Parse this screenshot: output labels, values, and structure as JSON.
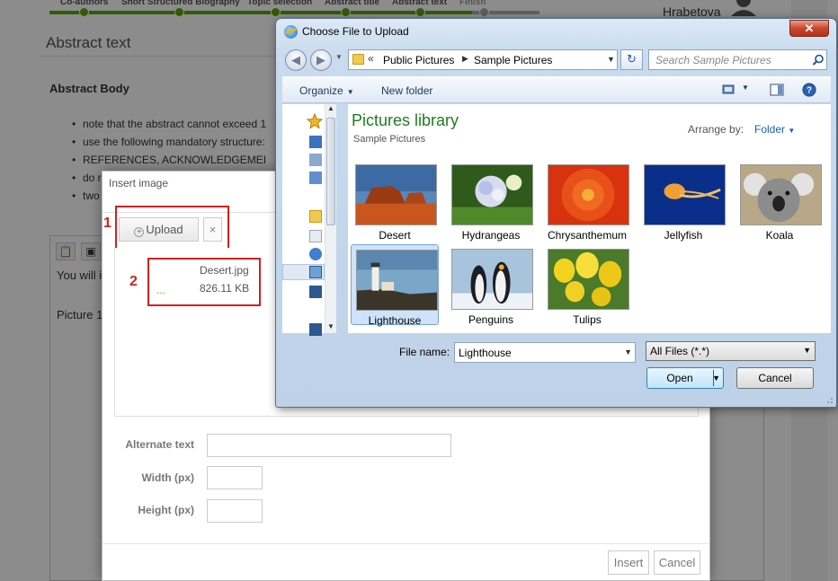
{
  "background_page": {
    "wizard_steps": [
      "Co-authors",
      "Short Structured Biography",
      "Topic selection",
      "Abstract title",
      "Abstract text",
      "Finish"
    ],
    "user_name": "Hrabetova",
    "page_heading": "Abstract text",
    "section_title": "Abstract Body",
    "bullets": [
      "note that the abstract cannot exceed 1",
      "use the following mandatory structure:",
      "REFERENCES, ACKNOWLEDGEMEI",
      "do n",
      "two"
    ],
    "editor_text_1": "You will i",
    "editor_text_2": "Picture 1"
  },
  "insert_dialog": {
    "title": "Insert image",
    "upload_label": "Upload",
    "clear_glyph": "×",
    "file_name": "Desert.jpg",
    "file_size": "826.11 KB",
    "file_progress": "...",
    "callout_1": "1",
    "callout_2": "2",
    "alt_text_label": "Alternate text",
    "width_label": "Width (px)",
    "height_label": "Height (px)",
    "insert_label": "Insert",
    "cancel_label": "Cancel"
  },
  "file_dialog": {
    "title": "Choose File to Upload",
    "close_glyph": "✕",
    "address_chevron": "«",
    "breadcrumb": [
      "Public Pictures",
      "Sample Pictures"
    ],
    "search_placeholder": "Search Sample Pictures",
    "toolbar": {
      "organize": "Organize",
      "new_folder": "New folder"
    },
    "library_title": "Pictures library",
    "library_subtitle": "Sample Pictures",
    "arrange_label": "Arrange by:",
    "arrange_value": "Folder",
    "thumbnails": [
      {
        "label": "Desert"
      },
      {
        "label": "Hydrangeas"
      },
      {
        "label": "Chrysanthemum"
      },
      {
        "label": "Jellyfish"
      },
      {
        "label": "Koala"
      },
      {
        "label": "Lighthouse",
        "selected": true
      },
      {
        "label": "Penguins"
      },
      {
        "label": "Tulips"
      }
    ],
    "file_name_label": "File name:",
    "file_name_value": "Lighthouse",
    "filter_value": "All Files (*.*)",
    "open_label": "Open",
    "cancel_label": "Cancel"
  },
  "colors": {
    "wizard_green": "#5aa60a",
    "callout_red": "#d32020",
    "library_green": "#1e7d20",
    "link_blue": "#1e5ea8",
    "close_red": "#c8482c"
  }
}
